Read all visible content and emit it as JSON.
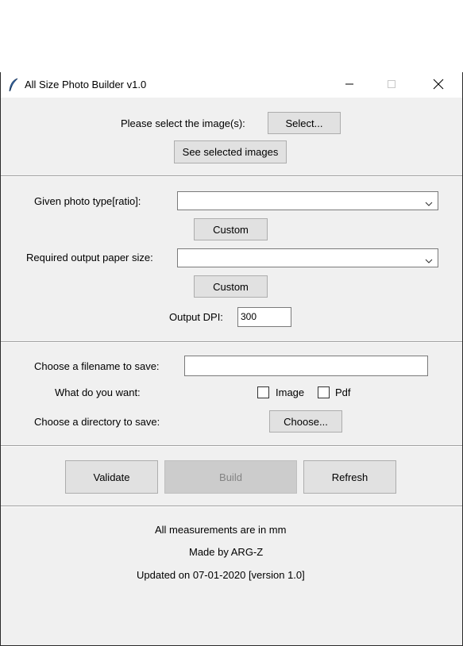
{
  "window": {
    "title": "All Size Photo Builder v1.0",
    "icon": "feather-icon",
    "controls": {
      "minimize": "minimize-icon",
      "maximize": "maximize-icon",
      "close": "close-icon"
    }
  },
  "select_section": {
    "prompt": "Please select the image(s):",
    "select_button": "Select...",
    "see_button": "See selected images"
  },
  "config_section": {
    "photo_type_label": "Given photo type[ratio]:",
    "photo_type_value": "",
    "custom_button_1": "Custom",
    "paper_size_label": "Required output paper size:",
    "paper_size_value": "",
    "custom_button_2": "Custom",
    "dpi_label": "Output DPI:",
    "dpi_value": "300"
  },
  "save_section": {
    "filename_label": "Choose a filename to save:",
    "filename_value": "",
    "want_label": "What do you want:",
    "image_option": "Image",
    "image_checked": false,
    "pdf_option": "Pdf",
    "pdf_checked": false,
    "directory_label": "Choose a directory to save:",
    "choose_button": "Choose..."
  },
  "actions": {
    "validate": "Validate",
    "build": "Build",
    "build_disabled": true,
    "refresh": "Refresh"
  },
  "footer": {
    "line1": "All measurements are in mm",
    "line2": "Made by ARG-Z",
    "line3": "Updated on 07-01-2020 [version 1.0]"
  },
  "colors": {
    "window_bg": "#f0f0f0",
    "button_bg": "#e1e1e1",
    "button_border": "#adadad",
    "disabled_bg": "#cccccc",
    "disabled_text": "#838383"
  }
}
